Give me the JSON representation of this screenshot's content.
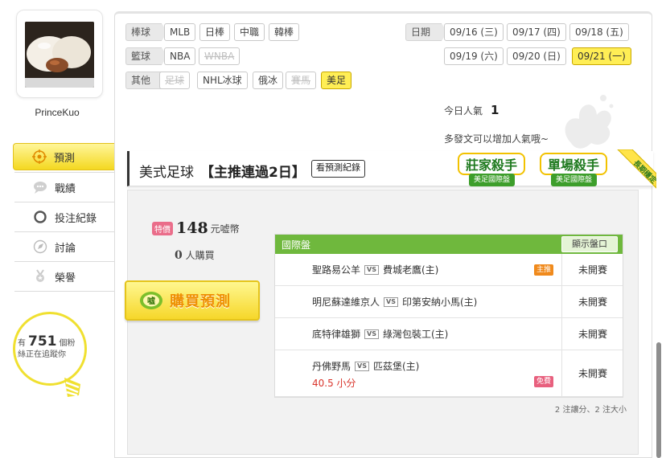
{
  "user": {
    "name": "PrinceKuo"
  },
  "sidebar": {
    "items": [
      {
        "label": "預測",
        "icon": "target-icon",
        "active": true
      },
      {
        "label": "戰績",
        "icon": "chat-bubble-icon",
        "active": false
      },
      {
        "label": "投注紀錄",
        "icon": "ring-icon",
        "active": false
      },
      {
        "label": "討論",
        "icon": "compass-icon",
        "active": false
      },
      {
        "label": "榮譽",
        "icon": "medal-icon",
        "active": false
      }
    ],
    "followers": {
      "prefix": "有",
      "count": "751",
      "unit": "個粉",
      "suffix": "絲正在追蹤你"
    }
  },
  "filters": {
    "baseball_label": "棒球",
    "baseball": [
      "MLB",
      "日棒",
      "中職",
      "韓棒"
    ],
    "basketball_label": "籃球",
    "basketball": [
      "NBA",
      "WNBA"
    ],
    "other_label": "其他",
    "other": [
      "足球",
      "NHL冰球",
      "俄冰",
      "賽馬",
      "美足"
    ],
    "date_label": "日期",
    "dates_row1": [
      "09/16 (三)",
      "09/17 (四)",
      "09/18 (五)"
    ],
    "dates_row2": [
      "09/19 (六)",
      "09/20 (日)",
      "09/21 (一)"
    ]
  },
  "popularity": {
    "label": "今日人氣",
    "value": "1",
    "hint": "多發文可以增加人氣哦~"
  },
  "section": {
    "sport": "美式足球",
    "streak": "【主推連過2日】",
    "history_button": "看預測紀錄",
    "badge1_main": "莊家殺手",
    "badge1_sub": "美足國際盤",
    "badge2_main": "單場殺手",
    "badge2_sub": "美足國際盤",
    "ribbon": "長期穩定"
  },
  "purchase": {
    "special_tag": "特價",
    "price": "148",
    "currency": "元嘘幣",
    "buyers_count": "0",
    "buyers_label": "人購買",
    "button_label": "購買預測",
    "button_icon_text": "嘘"
  },
  "odds": {
    "title": "國際盤",
    "toggle_button": "顯示盤口",
    "vs_text": "VS",
    "rows": [
      {
        "away": "聖路易公羊",
        "home": "費城老鷹(主)",
        "status": "未開賽",
        "tag": "主推",
        "pick": ""
      },
      {
        "away": "明尼蘇達維京人",
        "home": "印第安納小馬(主)",
        "status": "未開賽",
        "tag": "",
        "pick": ""
      },
      {
        "away": "底特律雄獅",
        "home": "綠灣包裝工(主)",
        "status": "未開賽",
        "tag": "",
        "pick": ""
      },
      {
        "away": "丹佛野馬",
        "home": "匹茲堡(主)",
        "status": "未開賽",
        "tag": "免費",
        "pick": "40.5 小分"
      }
    ],
    "summary": "2 注讓分、2 注大小"
  },
  "colors": {
    "accent_yellow": "#f6d72a",
    "table_green": "#6fb83d",
    "pick_red": "#d9342b",
    "badge_green": "#1f7a1f"
  }
}
